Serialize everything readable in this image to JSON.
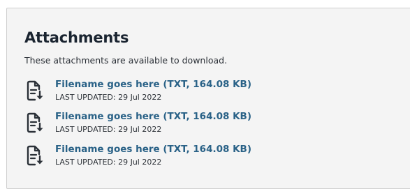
{
  "attachments_section": {
    "title": "Attachments",
    "intro": "These attachments are available to download.",
    "items": [
      {
        "filename": "Filename goes here (TXT, 164.08 KB)",
        "updated_label": "LAST UPDATED: ",
        "updated_date": "29 Jul 2022",
        "icon": "file-text-download-icon"
      },
      {
        "filename": "Filename goes here (TXT, 164.08 KB)",
        "updated_label": "LAST UPDATED: ",
        "updated_date": "29 Jul 2022",
        "icon": "file-text-download-icon"
      },
      {
        "filename": "Filename goes here (TXT, 164.08 KB)",
        "updated_label": "LAST UPDATED: ",
        "updated_date": "29 Jul 2022",
        "icon": "file-text-download-icon"
      }
    ]
  },
  "colors": {
    "panel_background": "#f4f4f4",
    "panel_border": "#cfcfcf",
    "heading": "#1a2430",
    "link": "#2a6287",
    "icon": "#2b3138"
  }
}
